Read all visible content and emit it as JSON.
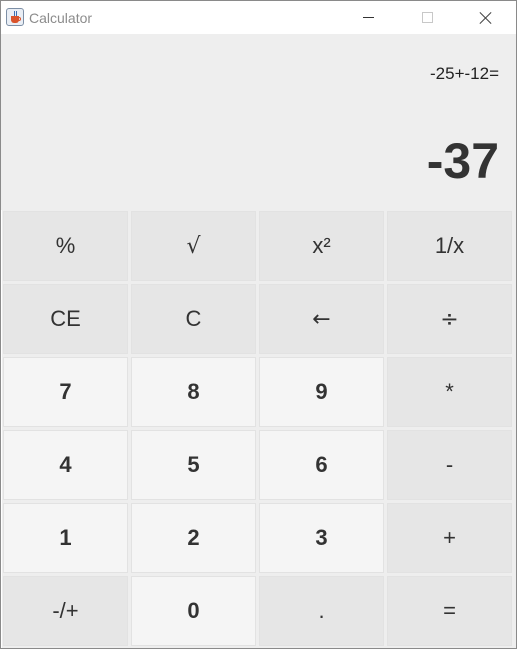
{
  "window": {
    "title": "Calculator"
  },
  "display": {
    "expression": "-25+-12=",
    "result": "-37"
  },
  "keys": {
    "percent": "%",
    "sqrt": "√",
    "square": "x²",
    "reciprocal": "1/x",
    "ce": "CE",
    "clear": "C",
    "backspace": "←",
    "divide": "÷",
    "seven": "7",
    "eight": "8",
    "nine": "9",
    "multiply": "*",
    "four": "4",
    "five": "5",
    "six": "6",
    "subtract": "-",
    "one": "1",
    "two": "2",
    "three": "3",
    "add": "+",
    "negate": "-/+",
    "zero": "0",
    "decimal": ".",
    "equals": "="
  }
}
